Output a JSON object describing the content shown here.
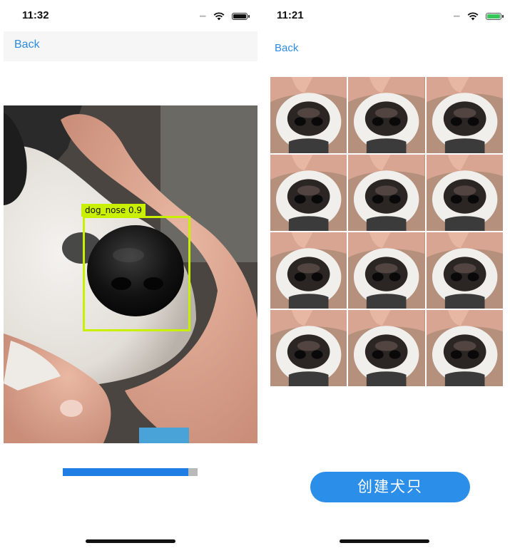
{
  "left_screen": {
    "status_bar": {
      "time": "11:32",
      "cell_dots": "••••",
      "wifi_icon": "wifi-icon",
      "battery_icon": "battery-icon"
    },
    "nav": {
      "back_label": "Back"
    },
    "detection": {
      "label": "dog_nose 0.9",
      "box_color": "#c8f000"
    },
    "progress": {
      "value_percent": 93,
      "fill_color": "#1f7de6",
      "track_color": "#b9b9b9"
    }
  },
  "right_screen": {
    "status_bar": {
      "time": "11:21",
      "cell_dots": "••••",
      "wifi_icon": "wifi-icon",
      "battery_icon": "battery-charging-icon"
    },
    "nav": {
      "back_label": "Back"
    },
    "grid": {
      "rows": 4,
      "columns": 3,
      "tile_count": 12
    },
    "create_button_label": "创建犬只",
    "accent_color": "#2b8ee8"
  }
}
